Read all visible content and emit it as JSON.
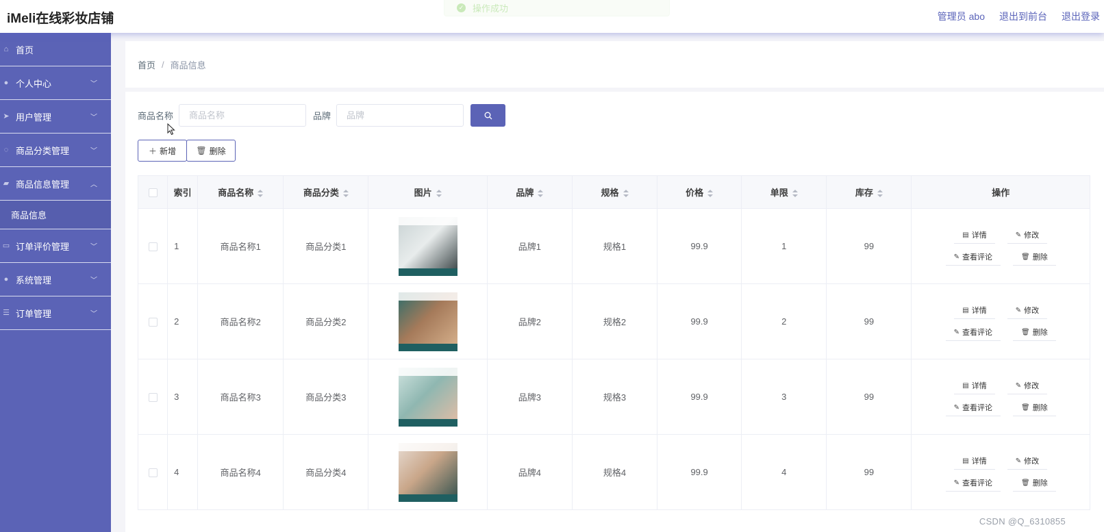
{
  "app": {
    "title": "iMeli在线彩妆店铺"
  },
  "header": {
    "links": [
      "管理员 abo",
      "退出到前台",
      "退出登录"
    ]
  },
  "toast": {
    "text": "操作成功",
    "color": "#67c23a"
  },
  "sidebar": {
    "items": [
      {
        "label": "首页",
        "icon": "home-icon",
        "expanded": null
      },
      {
        "label": "个人中心",
        "icon": "user-icon",
        "expanded": false
      },
      {
        "label": "用户管理",
        "icon": "send-icon",
        "expanded": false
      },
      {
        "label": "商品分类管理",
        "icon": "power-icon",
        "expanded": false
      },
      {
        "label": "商品信息管理",
        "icon": "thumb-up-icon",
        "expanded": true,
        "children": [
          "商品信息"
        ]
      },
      {
        "label": "订单评价管理",
        "icon": "chat-icon",
        "expanded": false
      },
      {
        "label": "系统管理",
        "icon": "location-icon",
        "expanded": false
      },
      {
        "label": "订单管理",
        "icon": "sliders-icon",
        "expanded": false
      }
    ],
    "bg_color": "#5b63b6"
  },
  "breadcrumb": {
    "home": "首页",
    "separator": "/",
    "current": "商品信息"
  },
  "search": {
    "name_label": "商品名称",
    "name_placeholder": "商品名称",
    "brand_label": "品牌",
    "brand_placeholder": "品牌"
  },
  "actions": {
    "add_label": "新增",
    "delete_label": "删除"
  },
  "table": {
    "columns": [
      "索引",
      "商品名称",
      "商品分类",
      "图片",
      "品牌",
      "规格",
      "价格",
      "单限",
      "库存",
      "操作"
    ],
    "rows": [
      {
        "index": "1",
        "name": "商品名称1",
        "category": "商品分类1",
        "brand": "品牌1",
        "spec": "规格1",
        "price": "99.9",
        "limit": "1",
        "stock": "99",
        "img_colors": [
          "#c9d3d4",
          "#2f3a3c",
          "#e8ecec"
        ]
      },
      {
        "index": "2",
        "name": "商品名称2",
        "category": "商品分类2",
        "brand": "品牌2",
        "spec": "规格2",
        "price": "99.9",
        "limit": "2",
        "stock": "99",
        "img_colors": [
          "#2e6d6b",
          "#d9b48f",
          "#a57a5a"
        ]
      },
      {
        "index": "3",
        "name": "商品名称3",
        "category": "商品分类3",
        "brand": "品牌3",
        "spec": "规格3",
        "price": "99.9",
        "limit": "3",
        "stock": "99",
        "img_colors": [
          "#cfe3df",
          "#e6bda5",
          "#8fb7b1"
        ]
      },
      {
        "index": "4",
        "name": "商品名称4",
        "category": "商品分类4",
        "brand": "品牌4",
        "spec": "规格4",
        "price": "99.9",
        "limit": "4",
        "stock": "99",
        "img_colors": [
          "#e7dcd3",
          "#2f4f4c",
          "#c9a689"
        ]
      }
    ],
    "row_actions": {
      "detail": "详情",
      "edit": "修改",
      "reviews": "查看评论",
      "delete": "删除"
    }
  },
  "watermark": "CSDN @Q_6310855"
}
